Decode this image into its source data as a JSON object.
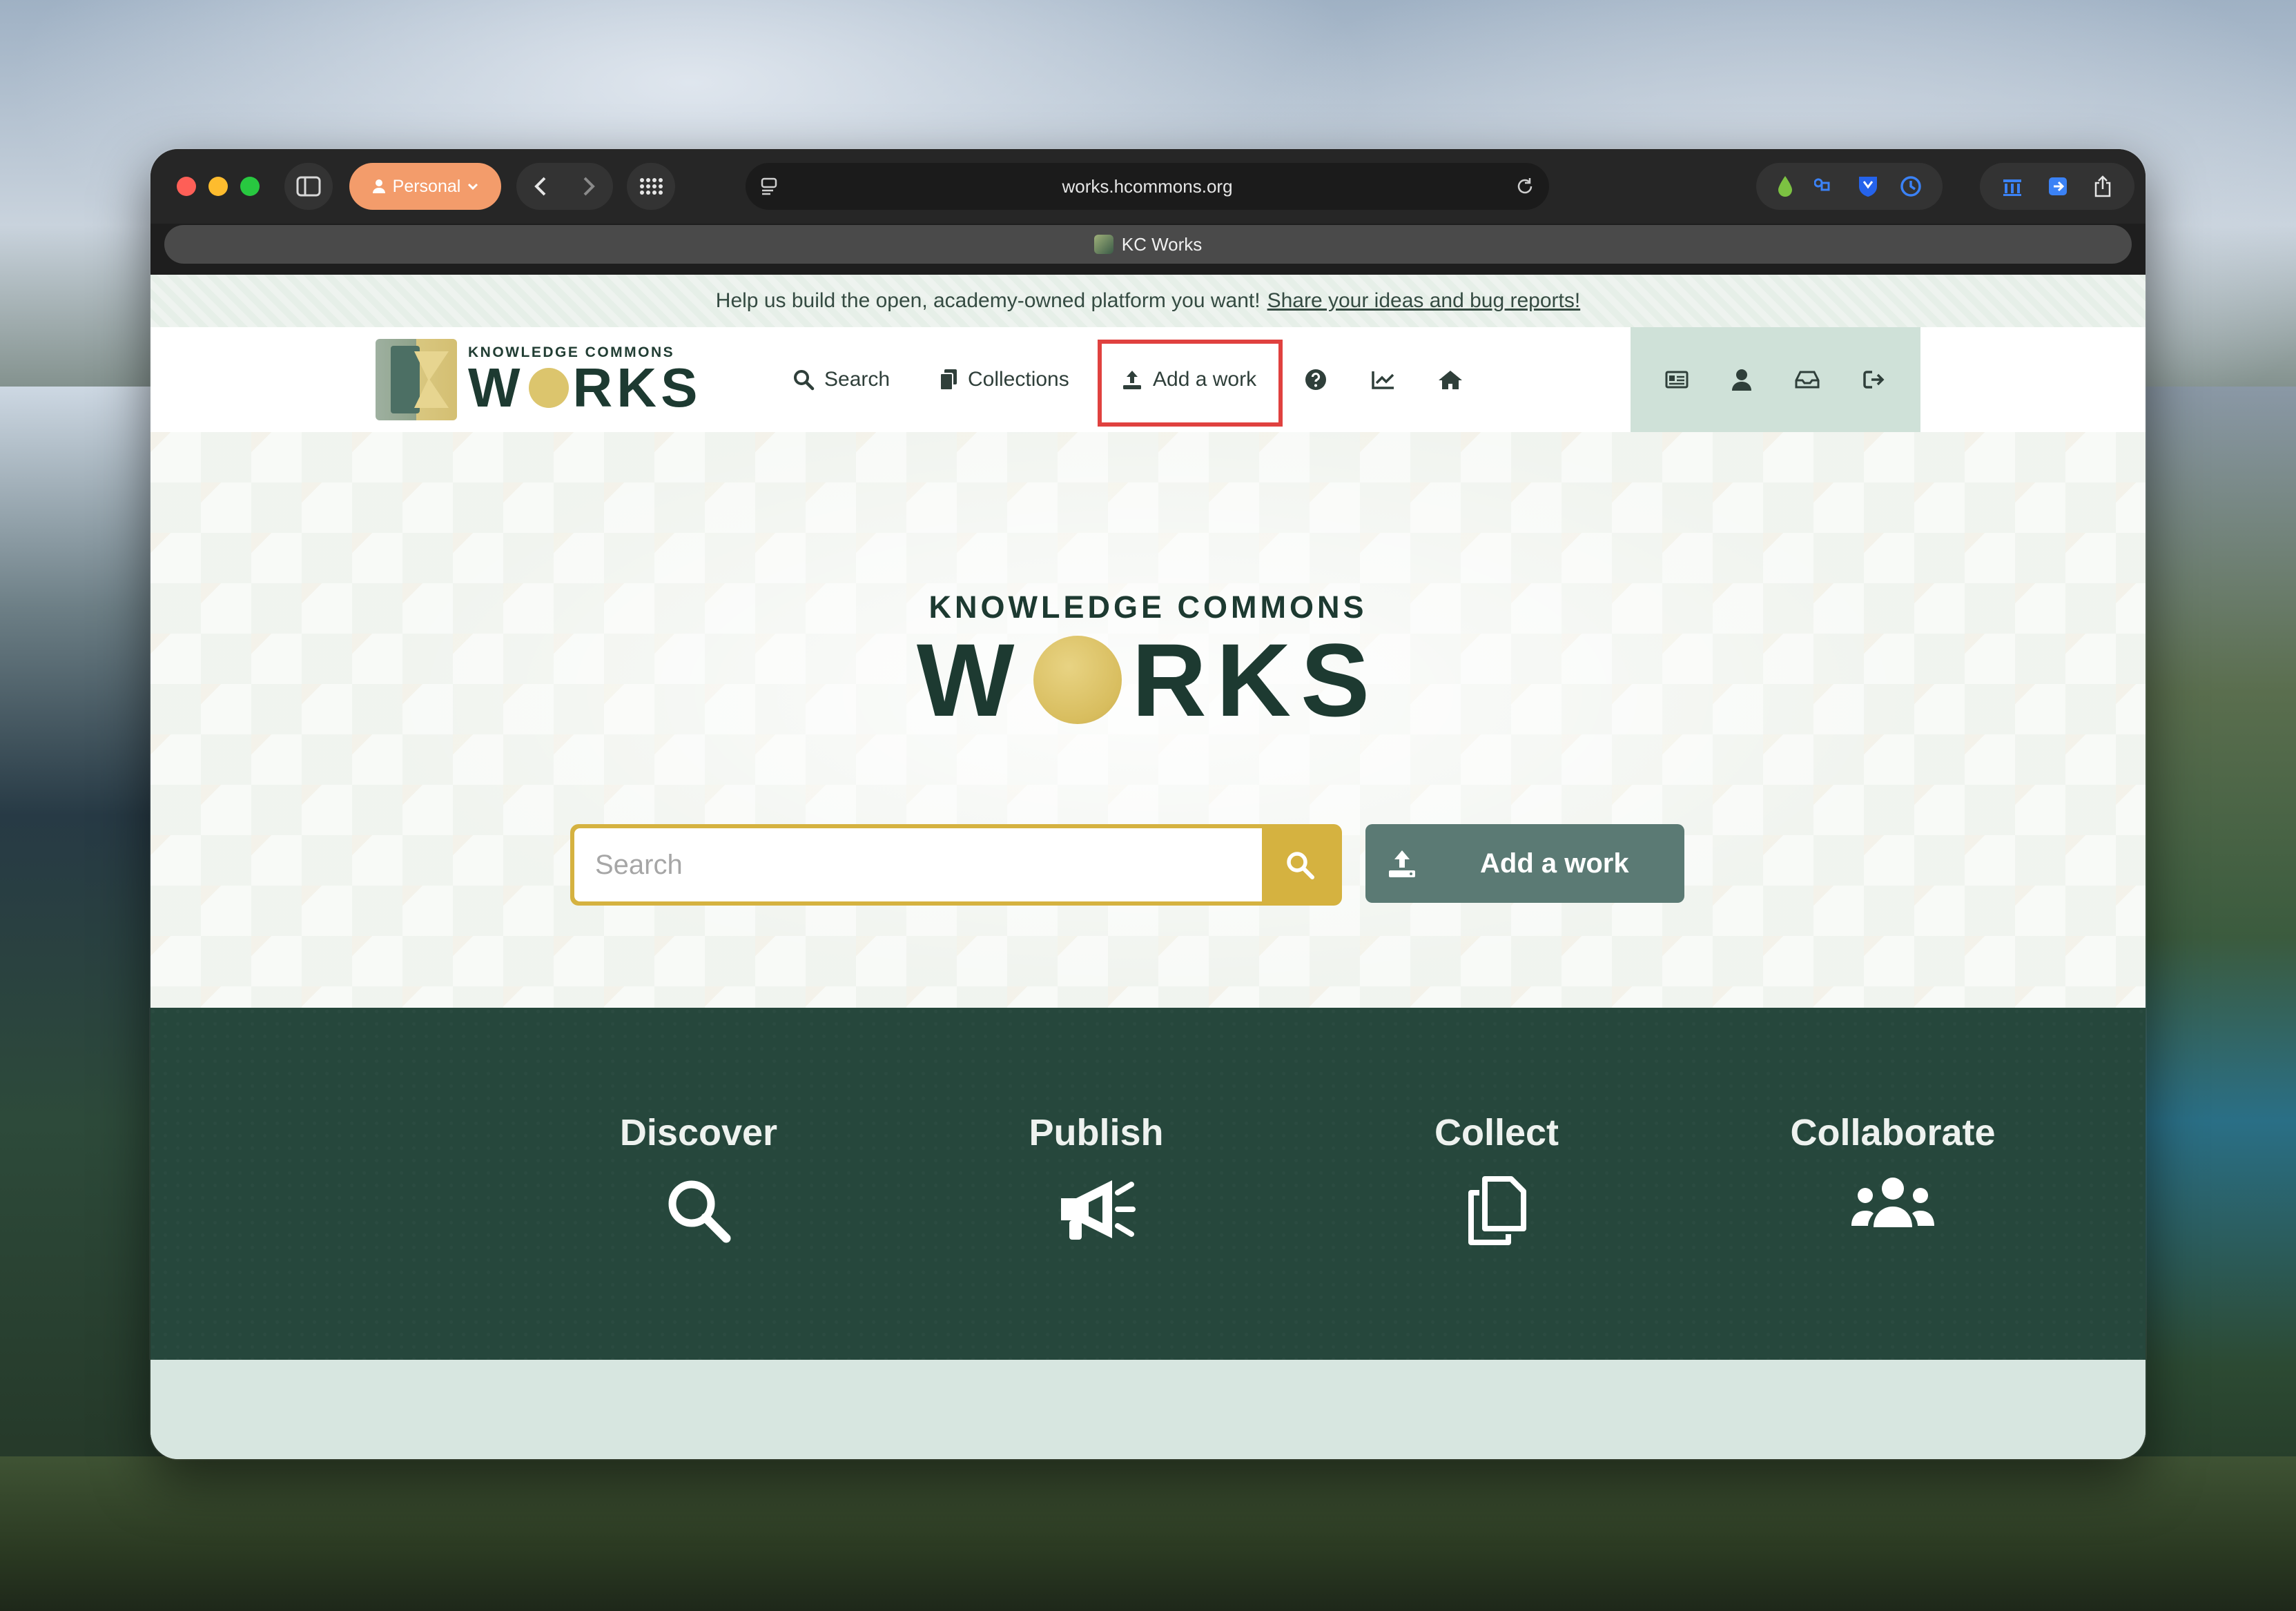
{
  "browser": {
    "profile_label": "Personal",
    "address": "works.hcommons.org",
    "tab_title": "KC Works"
  },
  "banner": {
    "text": "Help us build the open, academy-owned platform you want!",
    "link": "Share your ideas and bug reports!"
  },
  "logo": {
    "small": "KNOWLEDGE COMMONS",
    "big_w": "W",
    "big_rest": "RKS"
  },
  "nav": {
    "search": "Search",
    "collections": "Collections",
    "add_work": "Add a work"
  },
  "hero": {
    "small": "KNOWLEDGE COMMONS",
    "big_w": "W",
    "big_rest": "RKS",
    "search_placeholder": "Search",
    "add_button": "Add a work"
  },
  "features": [
    {
      "title": "Discover",
      "icon": "search-icon"
    },
    {
      "title": "Publish",
      "icon": "megaphone-icon"
    },
    {
      "title": "Collect",
      "icon": "copy-icon"
    },
    {
      "title": "Collaborate",
      "icon": "users-icon"
    }
  ],
  "colors": {
    "brand_dark": "#1d3a31",
    "gold": "#d5b240",
    "button_teal": "#5b7a74",
    "features_bg": "#26473c",
    "highlight": "#e0413f"
  }
}
